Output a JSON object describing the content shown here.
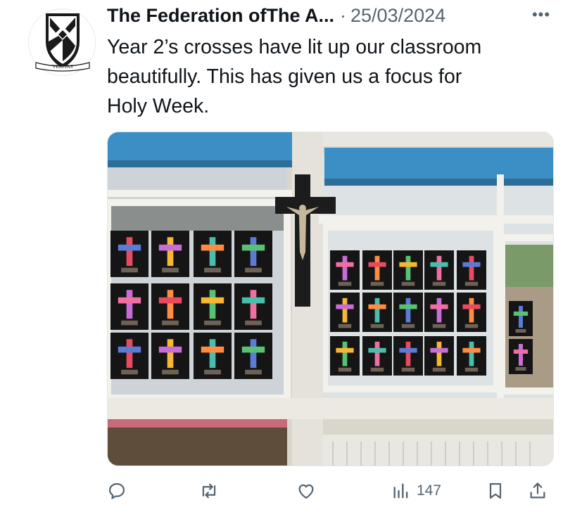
{
  "post": {
    "author": "The Federation ofThe A...",
    "separator": "·",
    "date": "25/03/2024",
    "text_lines": [
      "Year 2’s crosses have lit up our classroom",
      "beautifully. This has given us a focus for",
      "Holy Week."
    ],
    "avatar_text": "VERITAS"
  },
  "actions": {
    "views_count": "147"
  },
  "icons": {
    "more": "more-icon",
    "reply": "reply-icon",
    "repost": "repost-icon",
    "like": "like-icon",
    "views": "views-icon",
    "bookmark": "bookmark-icon",
    "share": "share-icon"
  },
  "colors": {
    "text": "#0f1419",
    "secondary": "#536471",
    "blind": "#3b8fc4"
  }
}
